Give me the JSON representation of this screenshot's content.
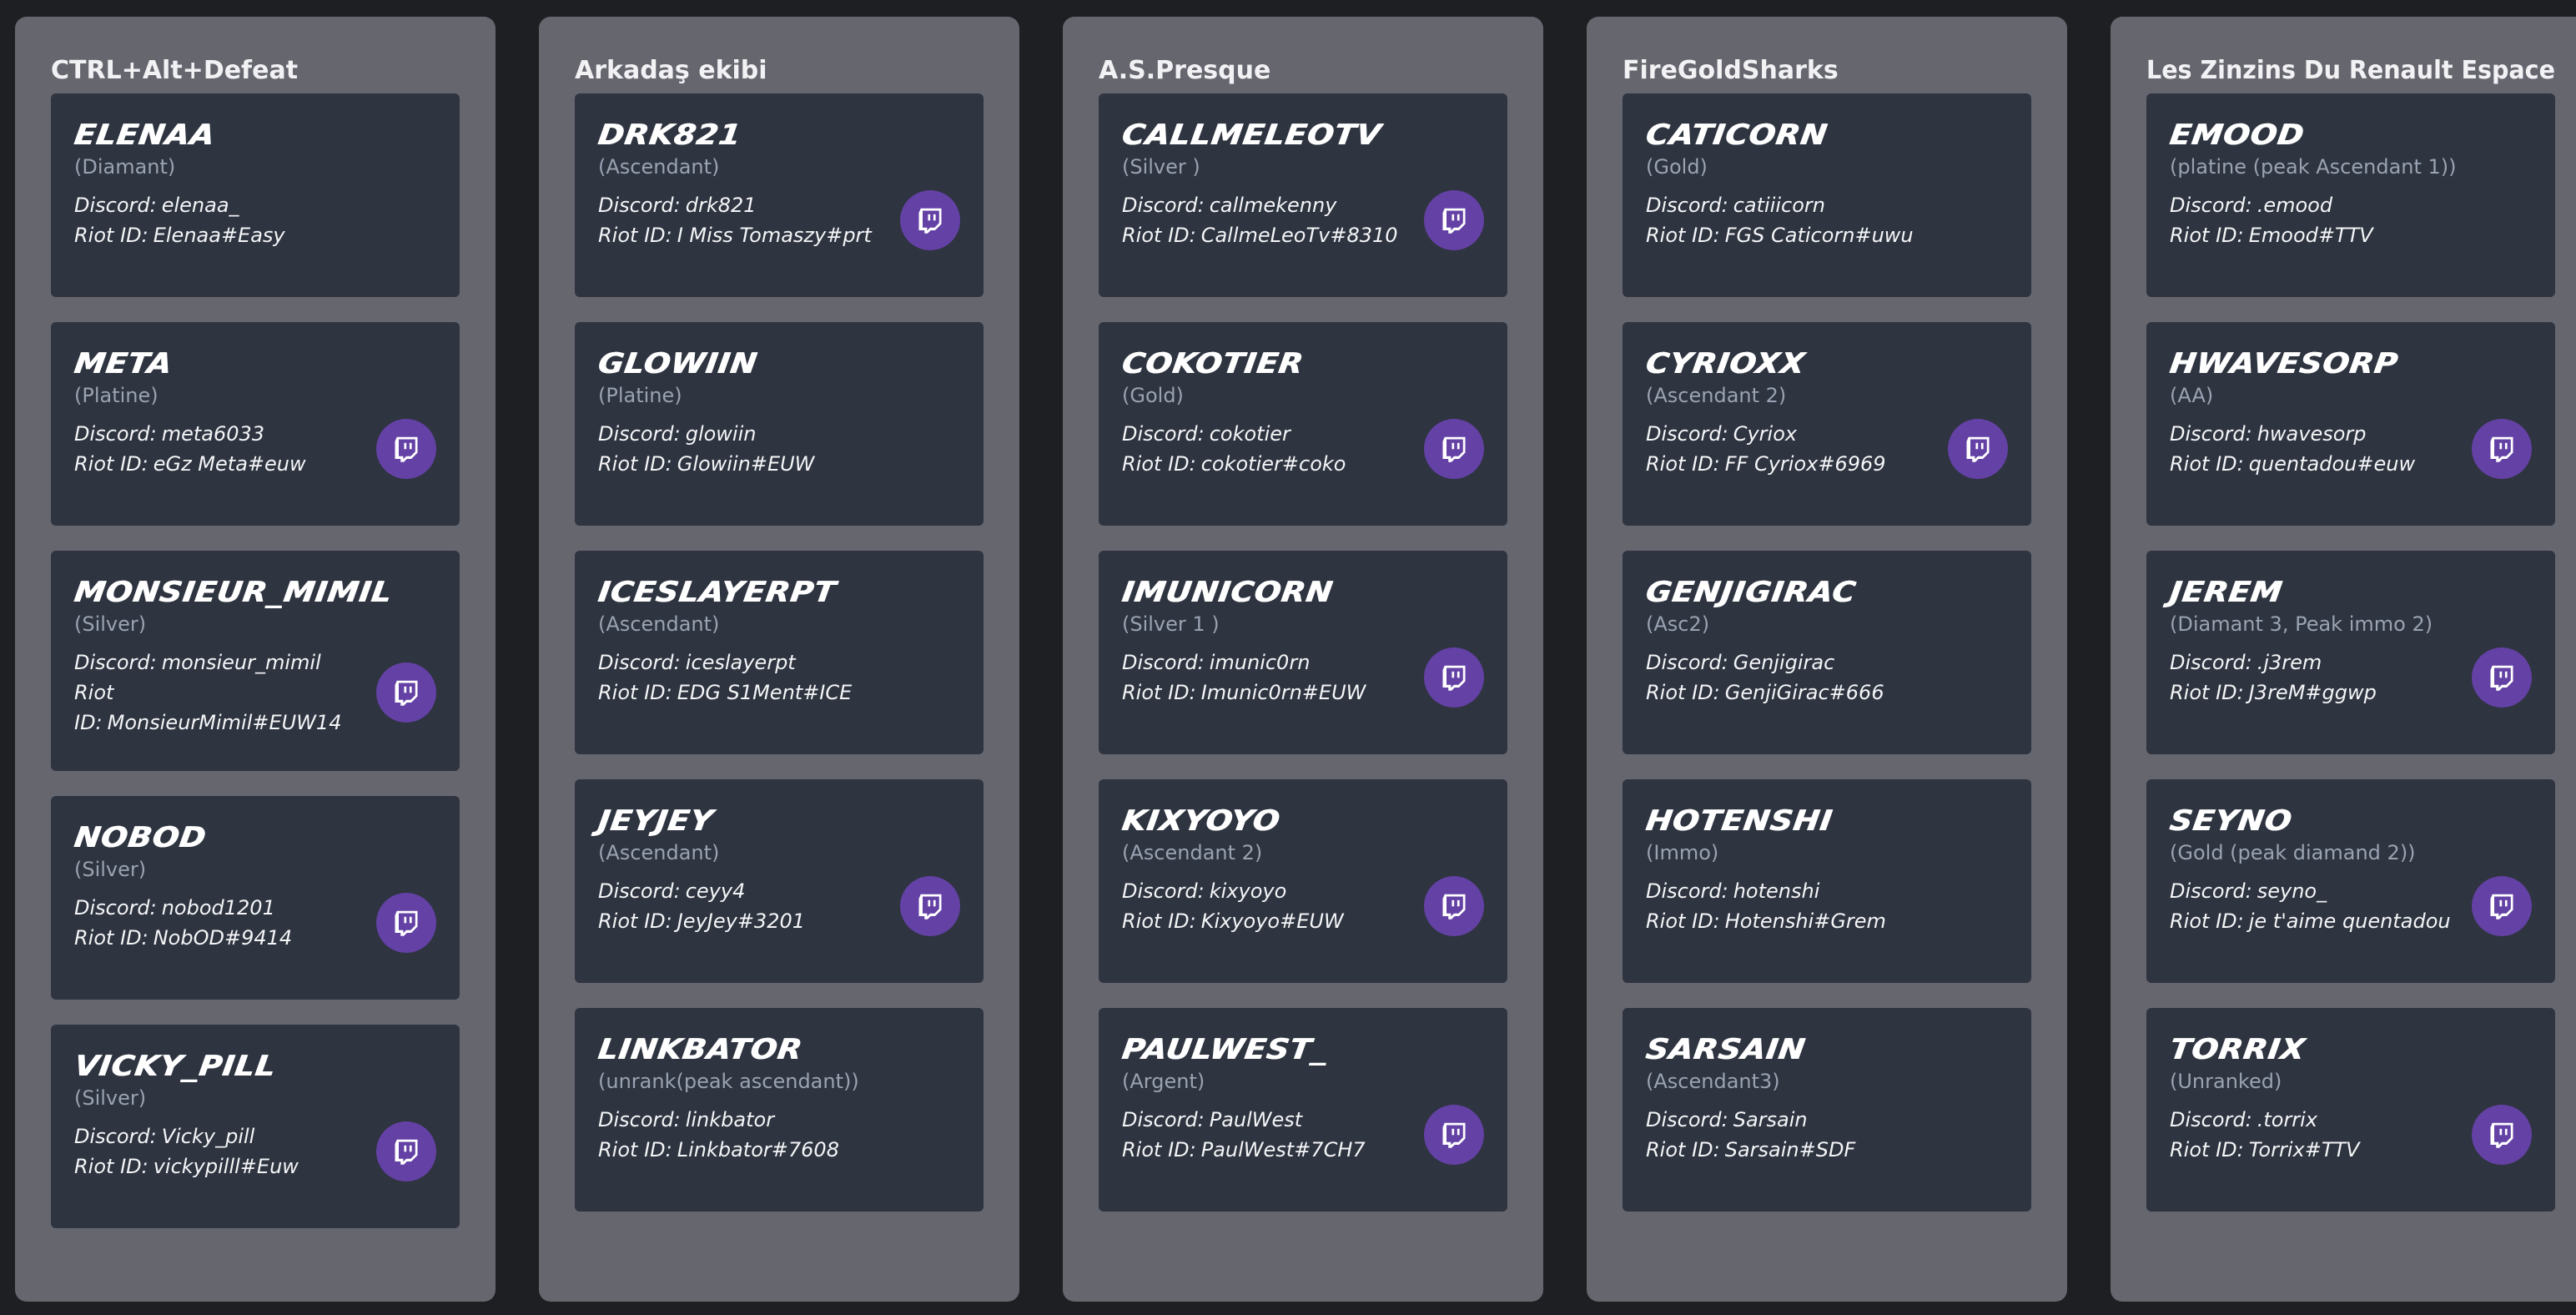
{
  "labels": {
    "discord": "Discord:",
    "riot": "Riot ID:"
  },
  "colors": {
    "page_bg": "#1e1f22",
    "column_bg": "#66666f",
    "card_bg": "#2e3440",
    "twitch": "#6441a5",
    "rank_text": "#9aa3b2"
  },
  "icons": {
    "twitch": "twitch-icon"
  },
  "teams": [
    {
      "name": "CTRL+Alt+Defeat",
      "players": [
        {
          "name": "Elenaa",
          "rank": "(Diamant)",
          "discord": "elenaa_",
          "riot": "Elenaa#Easy",
          "twitch": false
        },
        {
          "name": "meta",
          "rank": "(Platine)",
          "discord": "meta6033",
          "riot": "eGz Meta#euw",
          "twitch": true
        },
        {
          "name": "monsieur_mimil",
          "rank": "(Silver)",
          "discord": "monsieur_mimil",
          "riot": "MonsieurMimil#EUW14",
          "twitch": true
        },
        {
          "name": "NobOD",
          "rank": "(Silver)",
          "discord": "nobod1201",
          "riot": "NobOD#9414",
          "twitch": true
        },
        {
          "name": "Vicky_pill",
          "rank": "(Silver)",
          "discord": "Vicky_pill",
          "riot": "vickypilll#Euw",
          "twitch": true
        }
      ]
    },
    {
      "name": "Arkadaş ekibi",
      "players": [
        {
          "name": "drk821",
          "rank": "(Ascendant)",
          "discord": "drk821",
          "riot": "I Miss Tomaszy#prt",
          "twitch": true
        },
        {
          "name": "Glowiin",
          "rank": "(Platine)",
          "discord": "glowiin",
          "riot": "Glowiin#EUW",
          "twitch": false
        },
        {
          "name": "IceSlayerPT",
          "rank": "(Ascendant)",
          "discord": "iceslayerpt",
          "riot": "EDG S1Ment#ICE",
          "twitch": false
        },
        {
          "name": "JeyJey",
          "rank": "(Ascendant)",
          "discord": "ceyy4",
          "riot": "JeyJey#3201",
          "twitch": true
        },
        {
          "name": "Linkbator",
          "rank": "(unrank(peak ascendant))",
          "discord": "linkbator",
          "riot": "Linkbator#7608",
          "twitch": false
        }
      ]
    },
    {
      "name": "A.S.Presque",
      "players": [
        {
          "name": "CallmeLeoTV",
          "rank": "(Silver )",
          "discord": "callmekenny",
          "riot": "CallmeLeoTv#8310",
          "twitch": true
        },
        {
          "name": "cokotier",
          "rank": "(Gold)",
          "discord": "cokotier",
          "riot": "cokotier#coko",
          "twitch": true
        },
        {
          "name": "Imunicorn",
          "rank": "(Silver 1 )",
          "discord": "imunic0rn",
          "riot": "Imunic0rn#EUW",
          "twitch": true
        },
        {
          "name": "Kixyoyo",
          "rank": "(Ascendant 2)",
          "discord": "kixyoyo",
          "riot": "Kixyoyo#EUW",
          "twitch": true
        },
        {
          "name": "PaulWest_",
          "rank": "(Argent)",
          "discord": "PaulWest",
          "riot": "PaulWest#7CH7",
          "twitch": true
        }
      ]
    },
    {
      "name": "FireGoldSharks",
      "players": [
        {
          "name": "Caticorn",
          "rank": "(Gold)",
          "discord": "catiiicorn",
          "riot": "FGS Caticorn#uwu",
          "twitch": false
        },
        {
          "name": "Cyrioxx",
          "rank": "(Ascendant 2)",
          "discord": "Cyriox",
          "riot": "FF Cyriox#6969",
          "twitch": true
        },
        {
          "name": "Genjigirac",
          "rank": "(Asc2)",
          "discord": "Genjigirac",
          "riot": "GenjiGirac#666",
          "twitch": false
        },
        {
          "name": "Hotenshi",
          "rank": "(Immo)",
          "discord": "hotenshi",
          "riot": "Hotenshi#Grem",
          "twitch": false
        },
        {
          "name": "Sarsain",
          "rank": "(Ascendant3)",
          "discord": "Sarsain",
          "riot": "Sarsain#SDF",
          "twitch": false
        }
      ]
    },
    {
      "name": "Les Zinzins Du Renault Espace",
      "players": [
        {
          "name": "Emood",
          "rank": "(platine (peak Ascendant 1))",
          "discord": ".emood",
          "riot": "Emood#TTV",
          "twitch": false
        },
        {
          "name": "hwavesorp",
          "rank": "(AA)",
          "discord": "hwavesorp",
          "riot": "quentadou#euw",
          "twitch": true
        },
        {
          "name": "Jerem",
          "rank": "(Diamant 3, Peak immo 2)",
          "discord": ".j3rem",
          "riot": "J3reM#ggwp",
          "twitch": true
        },
        {
          "name": "Seyno",
          "rank": "(Gold (peak diamand 2))",
          "discord": "seyno_",
          "riot": "je t'aime quentadou",
          "twitch": true
        },
        {
          "name": "Torrix",
          "rank": "(Unranked)",
          "discord": ".torrix",
          "riot": "Torrix#TTV",
          "twitch": true
        }
      ]
    }
  ]
}
